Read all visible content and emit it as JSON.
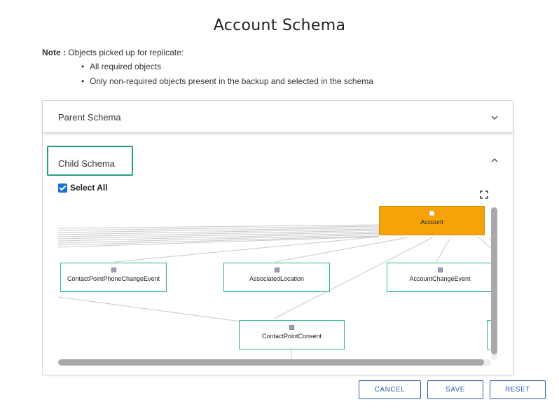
{
  "title": "Account Schema",
  "note": {
    "label": "Note :",
    "text": "Objects picked up for replicate:",
    "items": [
      "All required objects",
      "Only non-required objects present in the backup and selected in the schema"
    ]
  },
  "parent_schema": {
    "label": "Parent Schema",
    "icon": "chevron-down-icon"
  },
  "child_schema": {
    "label": "Child Schema",
    "icon": "chevron-up-icon",
    "accent": "#27a085"
  },
  "select_all": {
    "label": "Select All",
    "checked": true
  },
  "graph": {
    "root": {
      "label": "Account",
      "color": "#f6a30a"
    },
    "nodes": [
      {
        "label": "ContactPointPhoneChangeEvent"
      },
      {
        "label": "AssociatedLocation"
      },
      {
        "label": "AccountChangeEvent"
      },
      {
        "label": "ContactPointConsent"
      }
    ],
    "node_border": "#2bb588"
  },
  "buttons": {
    "cancel": "CANCEL",
    "save": "SAVE",
    "reset": "RESET"
  }
}
